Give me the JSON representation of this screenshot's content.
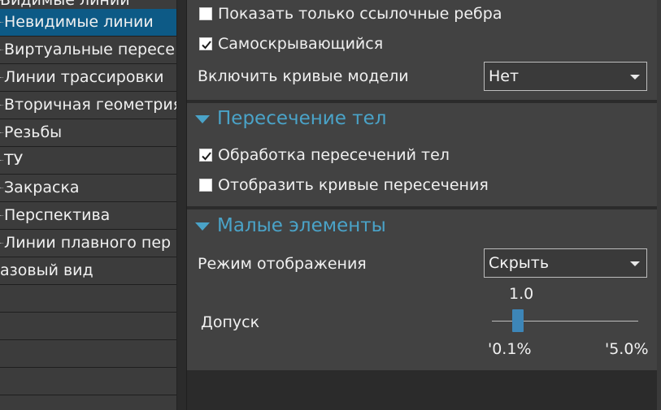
{
  "tree": {
    "items": [
      {
        "label": "Видимые линии",
        "selected": false
      },
      {
        "label": "Невидимые линии",
        "selected": true
      },
      {
        "label": "Виртуальные пересе",
        "selected": false
      },
      {
        "label": "Линии трассировки",
        "selected": false
      },
      {
        "label": "Вторичная геометрия",
        "selected": false
      },
      {
        "label": "Резьбы",
        "selected": false
      },
      {
        "label": "ТУ",
        "selected": false
      },
      {
        "label": "Закраска",
        "selected": false
      },
      {
        "label": "Перспектива",
        "selected": false
      },
      {
        "label": "Линии плавного пер",
        "selected": false
      },
      {
        "label": "азовый вид",
        "selected": false
      },
      {
        "label": "",
        "selected": false
      },
      {
        "label": "",
        "selected": false
      },
      {
        "label": "",
        "selected": false
      },
      {
        "label": "",
        "selected": false
      }
    ]
  },
  "hidden_lines": {
    "show_ref_edges": {
      "label": "Показать только ссылочные ребра",
      "checked": false
    },
    "self_hiding": {
      "label": "Самоскрывающийся",
      "checked": true
    },
    "model_curves": {
      "label": "Включить кривые модели",
      "value": "Нет"
    }
  },
  "body_intersection": {
    "title": "Пересечение тел",
    "process": {
      "label": "Обработка пересечений тел",
      "checked": true
    },
    "show_curves": {
      "label": "Отобразить кривые пересечения",
      "checked": false
    }
  },
  "small_elements": {
    "title": "Малые элементы",
    "display_mode": {
      "label": "Режим отображения",
      "value": "Скрыть"
    },
    "tolerance": {
      "label": "Допуск",
      "value": "1.0",
      "min_label": "'0.1%",
      "max_label": "'5.0%",
      "fraction": 0.18
    }
  }
}
